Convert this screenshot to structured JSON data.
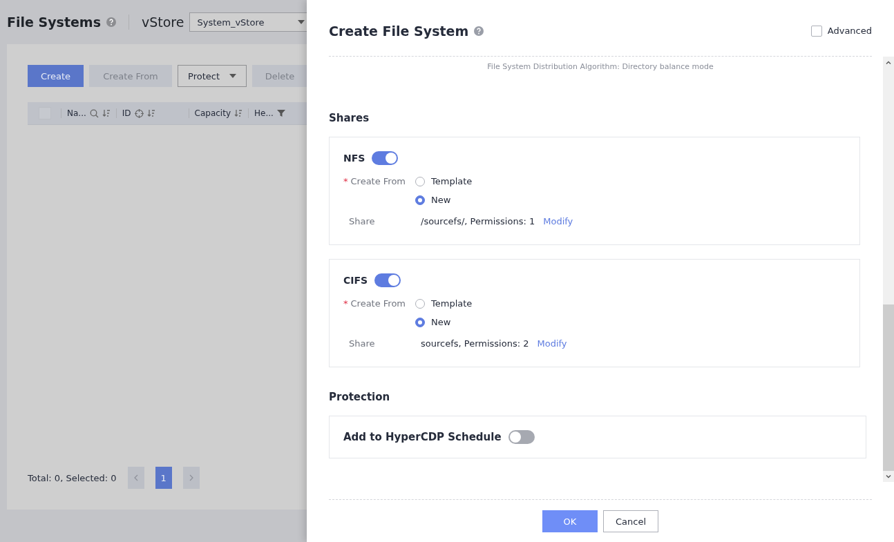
{
  "page": {
    "title": "File Systems",
    "vstore_label": "vStore",
    "vstore_value": "System_vStore",
    "toolbar": [
      {
        "label": "Create",
        "kind": "primary"
      },
      {
        "label": "Create From",
        "kind": "disabled"
      },
      {
        "label": "Protect",
        "kind": "dropdown"
      },
      {
        "label": "Delete",
        "kind": "disabled"
      }
    ],
    "select_all": {
      "checked": false
    },
    "columns": [
      {
        "label": "Na...",
        "kind": "search-sort"
      },
      {
        "label": "ID",
        "kind": "target-sort"
      },
      {
        "label": "Capacity",
        "kind": "sort"
      },
      {
        "label": "He...",
        "kind": "filter"
      }
    ],
    "total": "Total: 0, Selected: 0",
    "pages": [
      {
        "label": "1",
        "selected": true
      }
    ]
  },
  "dialog": {
    "title": "Create File System",
    "advanced": {
      "label": "Advanced",
      "checked": false
    },
    "note": "File System Distribution Algorithm: Directory balance mode",
    "shares_heading": "Shares",
    "shares": [
      {
        "name": "NFS",
        "on": true,
        "required_mark": "*",
        "create_from": "Create From",
        "options": [
          {
            "label": "Template",
            "selected": false
          },
          {
            "label": "New",
            "selected": true
          }
        ],
        "share_label": "Share",
        "share_value": "/sourcefs/, Permissions: 1",
        "modify": "Modify"
      },
      {
        "name": "CIFS",
        "on": true,
        "required_mark": "*",
        "create_from": "Create From",
        "options": [
          {
            "label": "Template",
            "selected": false
          },
          {
            "label": "New",
            "selected": true
          }
        ],
        "share_label": "Share",
        "share_value": "sourcefs, Permissions: 2",
        "modify": "Modify"
      }
    ],
    "protection_heading": "Protection",
    "protection": {
      "label": "Add to HyperCDP Schedule",
      "on": false
    },
    "buttons": [
      {
        "label": "OK",
        "kind": "primary"
      },
      {
        "label": "Cancel",
        "kind": "default"
      }
    ]
  }
}
